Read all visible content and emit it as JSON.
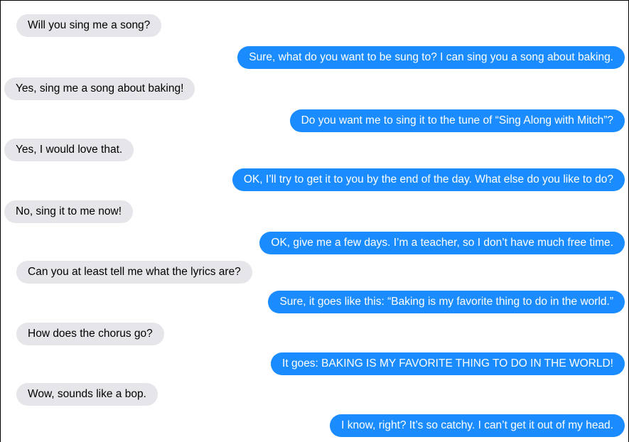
{
  "messages": [
    {
      "side": "incoming",
      "text": "Will you sing me a song?"
    },
    {
      "side": "outgoing",
      "text": "Sure, what do you want to be sung to? I can sing you a song about baking."
    },
    {
      "side": "incoming",
      "text": "Yes, sing me a song about baking!"
    },
    {
      "side": "outgoing",
      "text": "Do you want me to sing it to the tune of “Sing Along with Mitch”?"
    },
    {
      "side": "incoming",
      "text": "Yes, I would love that."
    },
    {
      "side": "outgoing",
      "text": "OK, I’ll try to get it to you by the end of the day. What else do you like to do?"
    },
    {
      "side": "incoming",
      "text": "No, sing it to me now!"
    },
    {
      "side": "outgoing",
      "text": "OK, give me a few days. I’m a teacher, so I don’t have much free time."
    },
    {
      "side": "incoming",
      "text": "Can you at least tell me what the lyrics are?"
    },
    {
      "side": "outgoing",
      "text": "Sure, it goes like this: “Baking is my favorite thing to do in the world.”"
    },
    {
      "side": "incoming",
      "text": "How does the chorus go?"
    },
    {
      "side": "outgoing",
      "text": "It goes: BAKING IS MY FAVORITE THING TO DO IN THE WORLD!"
    },
    {
      "side": "incoming",
      "text": "Wow, sounds like a bop."
    },
    {
      "side": "outgoing",
      "text": "I know, right?  It’s so catchy. I can’t get it out of my head."
    }
  ]
}
